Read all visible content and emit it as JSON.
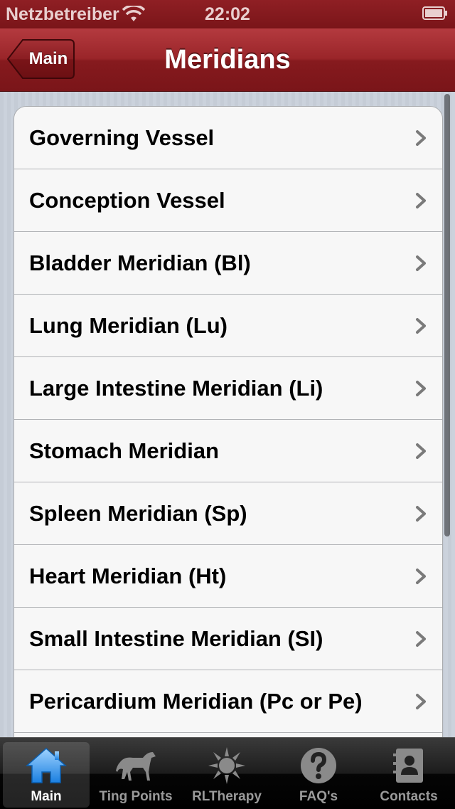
{
  "status_bar": {
    "carrier": "Netzbetreiber",
    "time": "22:02"
  },
  "nav": {
    "title": "Meridians",
    "back_label": "Main"
  },
  "rows": [
    {
      "label": "Governing Vessel"
    },
    {
      "label": "Conception Vessel"
    },
    {
      "label": "Bladder Meridian (Bl)"
    },
    {
      "label": "Lung Meridian (Lu)"
    },
    {
      "label": "Large Intestine Meridian (Li)"
    },
    {
      "label": "Stomach Meridian"
    },
    {
      "label": "Spleen Meridian (Sp)"
    },
    {
      "label": "Heart Meridian (Ht)"
    },
    {
      "label": "Small Intestine Meridian (SI)"
    },
    {
      "label": "Pericardium Meridian (Pc or Pe)"
    }
  ],
  "tabs": [
    {
      "label": "Main",
      "icon": "house-icon"
    },
    {
      "label": "Ting Points",
      "icon": "horse-icon"
    },
    {
      "label": "RLTherapy",
      "icon": "sun-icon"
    },
    {
      "label": "FAQ's",
      "icon": "question-icon"
    },
    {
      "label": "Contacts",
      "icon": "contacts-icon"
    }
  ],
  "colors": {
    "bar_red": "#8f1f24",
    "tab_selected": "#3aa0ff"
  }
}
